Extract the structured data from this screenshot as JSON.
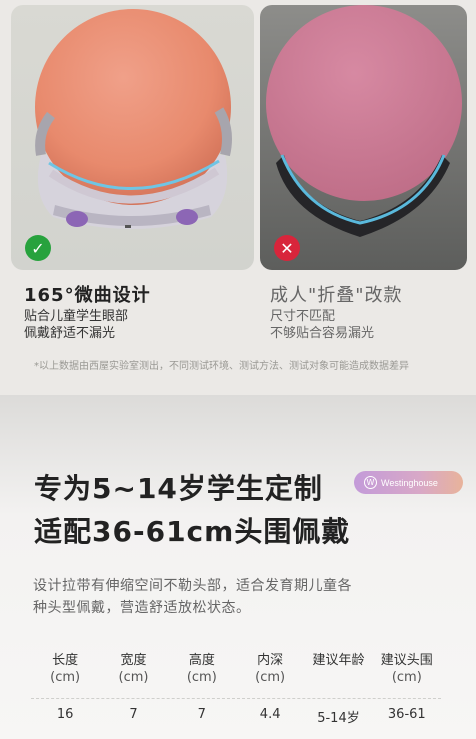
{
  "compare": {
    "good": {
      "title": "165°微曲设计",
      "lines": [
        "贴合儿童学生眼部",
        "佩戴舒适不漏光"
      ]
    },
    "bad": {
      "title": "成人\"折叠\"改款",
      "lines": [
        "尺寸不匹配",
        "不够贴合容易漏光"
      ]
    },
    "note": "*以上数据由西屋实验室测出，不同测试环境、测试方法、测试对象可能造成数据差异"
  },
  "headline": {
    "line1": "专为5~14岁学生定制",
    "line2": "适配36-61cm头围佩戴"
  },
  "brand": {
    "name": "Westinghouse",
    "logo": "W"
  },
  "description": "设计拉带有伸缩空间不勒头部，适合发育期儿童各种头型佩戴，营造舒适放松状态。",
  "specs": {
    "headers": [
      {
        "name": "长度",
        "unit": "(cm)"
      },
      {
        "name": "宽度",
        "unit": "(cm)"
      },
      {
        "name": "高度",
        "unit": "(cm)"
      },
      {
        "name": "内深",
        "unit": "(cm)"
      },
      {
        "name": "建议年龄",
        "unit": ""
      },
      {
        "name": "建议头围",
        "unit": "(cm)"
      }
    ],
    "values": [
      "16",
      "7",
      "7",
      "4.4",
      "5-14岁",
      "36-61"
    ]
  },
  "icons": {
    "good": "check-icon",
    "bad": "cross-icon"
  },
  "colors": {
    "good": "#27a23d",
    "bad": "#d8253b",
    "brand": "#c39bd9"
  }
}
